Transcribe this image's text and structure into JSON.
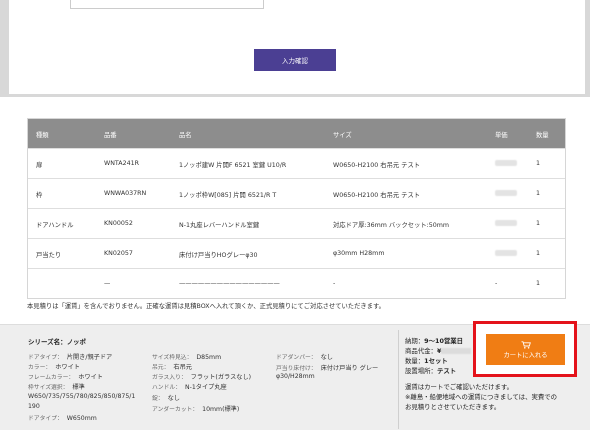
{
  "confirm_button": "入力確認",
  "table": {
    "headers": [
      "種類",
      "品番",
      "品名",
      "サイズ",
      "",
      "数量"
    ],
    "price_header": "単価",
    "rows": [
      {
        "type": "扉",
        "code": "WNTA241R",
        "name": "1ノッポ建W 片開F 6521 室鍵 U10/R",
        "size": "W0650-H2100 右吊元 テスト",
        "qty": "1"
      },
      {
        "type": "枠",
        "code": "WNWA037RN",
        "name": "1ノッポ枠W[085] 片開 6521/R T",
        "size": "W0650-H2100 右吊元 テスト",
        "qty": "1"
      },
      {
        "type": "ドアハンドル",
        "code": "KN00052",
        "name": "N-1丸座レバーハンドル室鍵",
        "size": "対応ドア厚:36mm バックセット:50mm",
        "qty": "1"
      },
      {
        "type": "戸当たり",
        "code": "KN02057",
        "name": "床付け戸当りHOグレーφ30",
        "size": "φ30mm H28mm",
        "qty": "1"
      },
      {
        "type": "",
        "code": "—",
        "name": "————————————————",
        "size": "-",
        "price": "-",
        "qty": "1"
      }
    ]
  },
  "note": "本見積りは「運賃」を含んでおりません。正確な運賃は見積BOXへ入れて頂くか、正式見積りにてご対応させていただきます。",
  "spec": {
    "series_label": "シリーズ名：",
    "series_value": "ノッポ",
    "door_type_label": "ドアタイプ：",
    "door_type": "片開き/親子ドア",
    "color_label": "カラー：",
    "color": "ホワイト",
    "frame_color_label": "フレームカラー：",
    "frame_color": "ホワイト",
    "frame_size_label": "枠サイズ選択：",
    "frame_size": "標準",
    "widths": "W650/735/755/780/825/850/875/1",
    "widths_cont": "190",
    "extra_cut": "W650mm",
    "extra_label": "ドアタイプ：",
    "frame_dim_label": "サイズ枠見込：",
    "frame_dim": "D85mm",
    "hinge_label": "吊元：",
    "hinge": "右吊元",
    "glass_label": "ガラス入り：",
    "glass": "フラット(ガラスなし)",
    "handle_label": "ハンドル：",
    "handle": "N-1タイプ丸座",
    "lock_label": "錠：",
    "lock": "なし",
    "undercut_label": "アンダーカット：",
    "undercut": "10mm(標準)",
    "damper_label": "ドアダンパー：",
    "damper": "なし",
    "stopper_label": "戸当り床付け：",
    "stopper": "床付け戸当り グレー",
    "stopper_size": "φ30/H28mm"
  },
  "order": {
    "delivery_label": "納期：",
    "delivery": "9～10営業日",
    "price_label": "商品代金：",
    "price_prefix": "¥",
    "qty_label": "数量：",
    "qty": "1セット",
    "place_label": "設置場所：",
    "place": "テスト",
    "note1": "運賃はカートでご確認いただけます。",
    "note2": "※離島・船便地域への運賃につきましては、実費での",
    "note3": "お見積りとさせていただきます。"
  },
  "cart_button": "カートに入れる",
  "colors": {
    "accent": "#4b3f93",
    "cart": "#f07d14",
    "highlight": "#e4131b",
    "table_header": "#8d8d8d"
  }
}
